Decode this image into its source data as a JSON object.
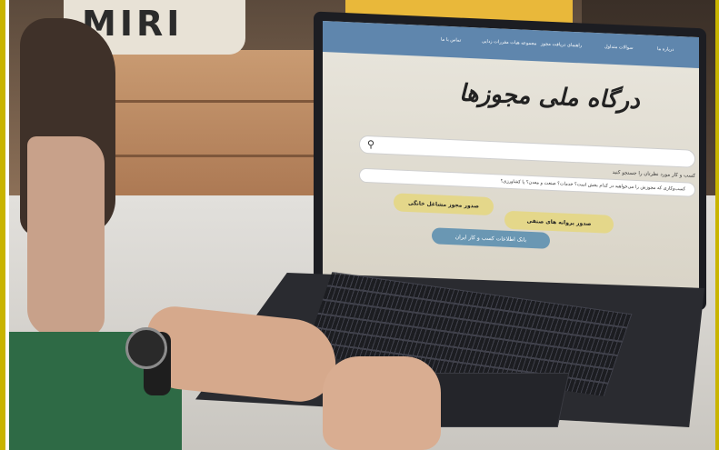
{
  "photo": {
    "pillow_text": "MIRI",
    "website": {
      "nav": [
        "درباره ما",
        "سوالات متداول",
        "راهنمای دریافت مجوز",
        "مجموعه هیات مقررات زدایی",
        "تماس با ما"
      ],
      "title": "درگاه ملی مجوزها",
      "search_hint": "کسب و کار مورد نظرتان را جستجو کنید",
      "question": "کسب‌وکاری که مجوزش را می‌خواهید در کدام بخش است؟ خدمات؟ صنعت و معدن؟ یا کشاورزی؟",
      "button_industry": "صدور پروانه های صنفی",
      "button_land": "صدور مجوز مشاغل خانگی",
      "button_bank": "بانک اطلاعات کسب و کار ایران",
      "search_icon": "search-icon"
    },
    "colors": {
      "accent_yellow": "#e4d78a",
      "nav_blue": "#5f86ad",
      "button_blue": "#6a97b3",
      "frame": "#c9b400"
    }
  }
}
